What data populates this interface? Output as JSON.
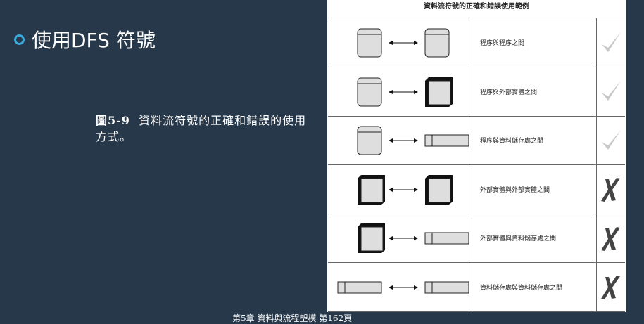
{
  "slide": {
    "bullet_text": "使用DFS 符號",
    "caption_fig": "圖5-9",
    "caption_text": "資料流符號的正確和錯誤的使用方式。",
    "footer": "第5章 資料與流程塑模 第162頁"
  },
  "table": {
    "title": "資料流符號的正確和錯誤使用範例",
    "rows": [
      {
        "label": "程序與程序之間",
        "left": "process",
        "right": "process",
        "valid": true
      },
      {
        "label": "程序與外部實體之間",
        "left": "process",
        "right": "entity",
        "valid": true
      },
      {
        "label": "程序與資料儲存處之間",
        "left": "process",
        "right": "store",
        "valid": true
      },
      {
        "label": "外部實體與外部實體之間",
        "left": "entity",
        "right": "entity",
        "valid": false
      },
      {
        "label": "外部實體與資料儲存處之間",
        "left": "entity",
        "right": "store",
        "valid": false
      },
      {
        "label": "資料儲存處與資料儲存處之間",
        "left": "store",
        "right": "store",
        "valid": false
      }
    ]
  },
  "icons": {
    "bullet": "ring-bullet-icon",
    "valid": "checkmark-icon",
    "invalid": "x-mark-icon"
  },
  "colors": {
    "background": "#26384a",
    "bullet_ring": "#3ba9d8",
    "check": "#c8c8c8",
    "cross": "#444444"
  }
}
